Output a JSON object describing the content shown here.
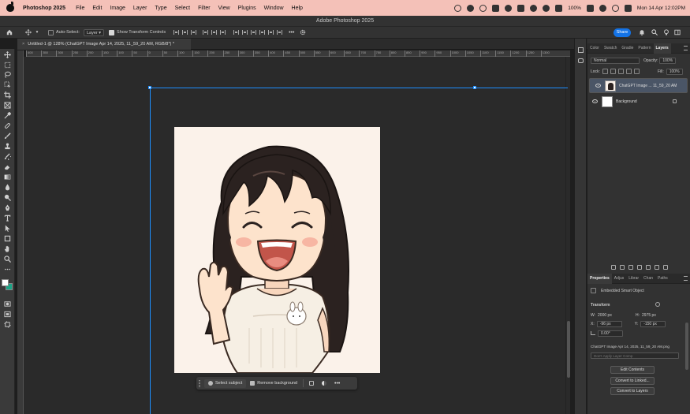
{
  "menubar": {
    "app_name": "Photoshop 2025",
    "items": [
      "File",
      "Edit",
      "Image",
      "Layer",
      "Type",
      "Select",
      "Filter",
      "View",
      "Plugins",
      "Window",
      "Help"
    ],
    "battery": "100%",
    "clock": "Mon 14 Apr  12:02PM"
  },
  "window": {
    "title": "Adobe Photoshop 2025"
  },
  "options_bar": {
    "auto_select_label": "Auto-Select:",
    "auto_select_value": "Layer",
    "show_transform_label": "Show Transform Controls",
    "more": "•••",
    "share_label": "Share"
  },
  "document": {
    "tab_title": "Untitled-1 @ 128% (ChatGPT Image Apr 14, 2025, 11_59_20 AM, RGB/8*) *",
    "close": "×"
  },
  "ruler": {
    "ticks": [
      "400",
      "350",
      "300",
      "250",
      "200",
      "150",
      "100",
      "50",
      "0",
      "50",
      "100",
      "150",
      "200",
      "250",
      "300",
      "350",
      "400",
      "450",
      "500",
      "550",
      "600",
      "650",
      "700",
      "750",
      "800",
      "850",
      "900",
      "950",
      "1000",
      "1050",
      "1100",
      "1150",
      "1200",
      "1250",
      "1300"
    ]
  },
  "context_bar": {
    "select_subject": "Select subject",
    "remove_background": "Remove background",
    "more": "•••"
  },
  "panels": {
    "top_tabs": [
      "Color",
      "Swatch",
      "Gradie",
      "Pattern",
      "Layers"
    ],
    "active_top": "Layers",
    "blend_mode": "Normal",
    "opacity_label": "Opacity:",
    "opacity_value": "100%",
    "lock_label": "Lock:",
    "fill_label": "Fill:",
    "fill_value": "100%",
    "layers": [
      {
        "name": "ChatGPT Image ... 11_59_20 AM",
        "selected": true
      },
      {
        "name": "Background",
        "selected": false
      }
    ],
    "bottom_tabs": [
      "Properties",
      "Adjus",
      "Librar",
      "Chan",
      "Paths"
    ],
    "active_bottom": "Properties",
    "properties": {
      "type": "Embedded Smart Object",
      "transform_label": "Transform",
      "w_label": "W:",
      "w_value": "2000 px",
      "h_label": "H:",
      "h_value": "2975 px",
      "x_label": "X:",
      "x_value": "-96 px",
      "y_label": "Y:",
      "y_value": "-150 px",
      "angle_value": "0.00°",
      "filename": "ChatGPT Image Apr 14, 2025, 11_59_20 AM.png",
      "layer_comp_placeholder": "Don't Apply Layer Comp",
      "buttons": [
        "Edit Contents",
        "Convert to Linked...",
        "Convert to Layers"
      ]
    }
  },
  "colors": {
    "menubar_bg": "#f4c1b8",
    "accent": "#1473e6",
    "guide": "#1e8fff",
    "canvas_bg": "#fbf2ea",
    "hair": "#2b2220",
    "skin": "#fde3cc",
    "shirt": "#f6efe4",
    "mouth": "#c2554a"
  }
}
